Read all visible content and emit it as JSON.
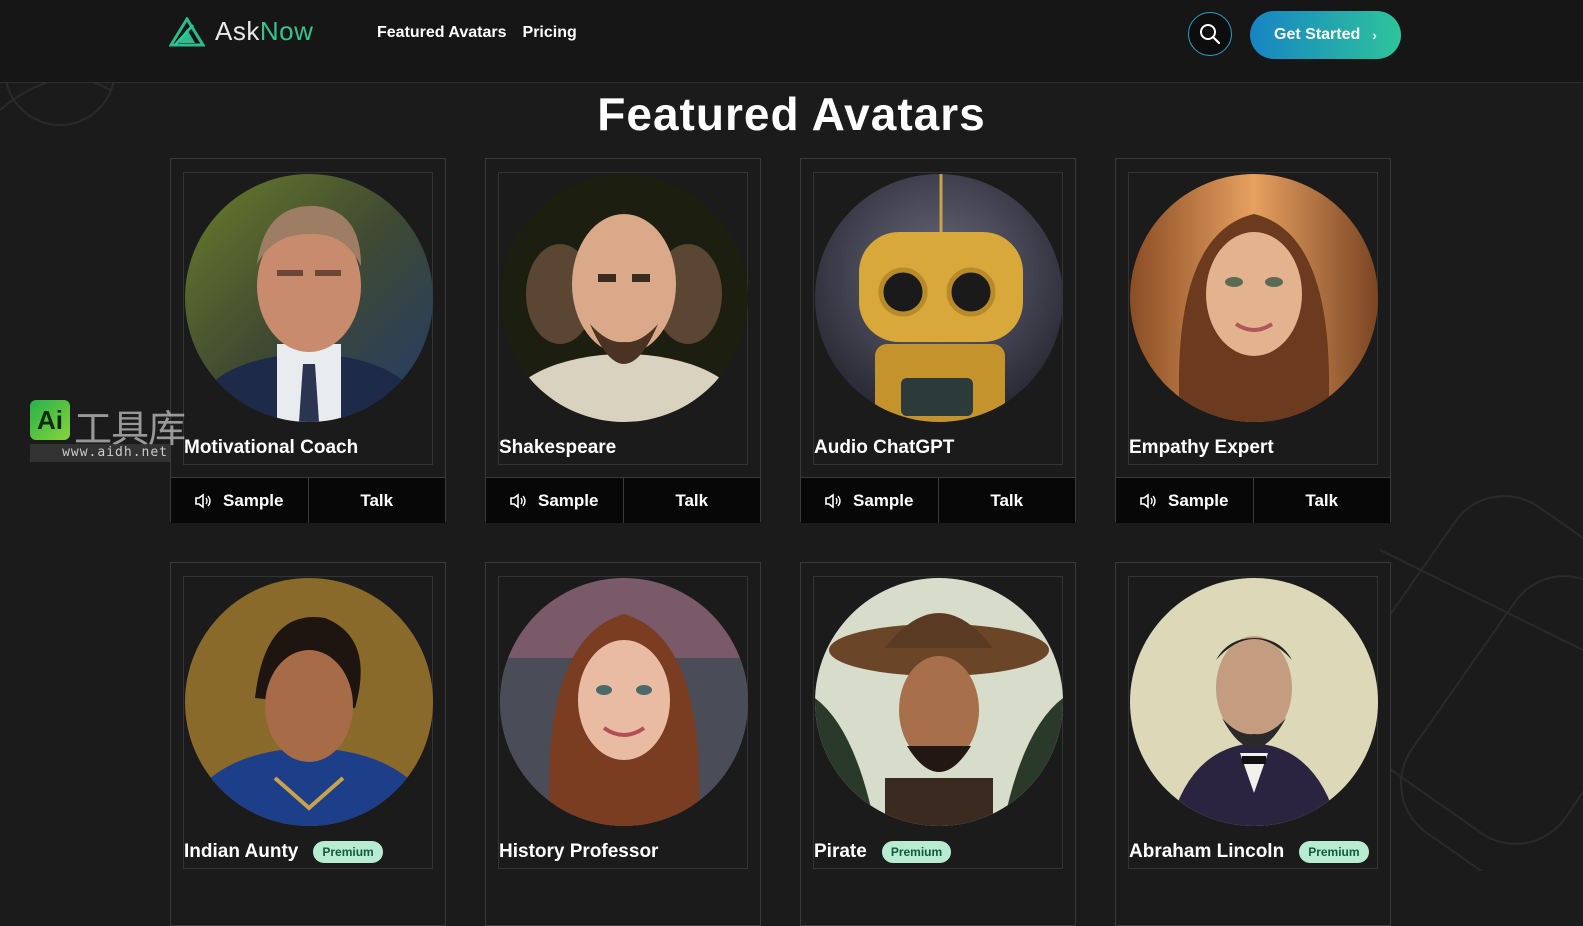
{
  "nav": {
    "brand_ask": "Ask",
    "brand_now": "Now",
    "links": [
      "Featured Avatars",
      "Pricing"
    ],
    "cta_label": "Get Started",
    "search_icon": "search-icon",
    "cta_icon": "chevron-right-icon"
  },
  "section": {
    "title": "Featured Avatars"
  },
  "actions": {
    "sample_label": "Sample",
    "talk_label": "Talk",
    "sample_icon": "speaker-icon"
  },
  "avatars": [
    {
      "name": "Motivational Coach",
      "badge": ""
    },
    {
      "name": "Shakespeare",
      "badge": ""
    },
    {
      "name": "Audio ChatGPT",
      "badge": ""
    },
    {
      "name": "Empathy Expert",
      "badge": ""
    },
    {
      "name": "Indian Aunty",
      "badge": "Premium"
    },
    {
      "name": "History Professor",
      "badge": ""
    },
    {
      "name": "Pirate",
      "badge": "Premium"
    },
    {
      "name": "Abraham Lincoln",
      "badge": "Premium"
    }
  ],
  "watermark": {
    "mark": "Ai",
    "text": "工具库",
    "url": "www.aidh.net"
  },
  "colors": {
    "accent_green": "#35c48d",
    "cta_start": "#1684c4",
    "cta_end": "#2ec49a",
    "badge_bg": "#b8ecd0"
  }
}
